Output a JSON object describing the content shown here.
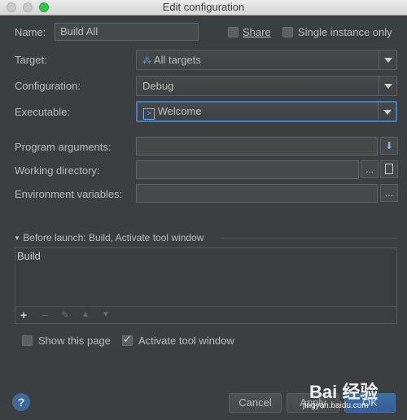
{
  "window": {
    "title": "Edit configuration"
  },
  "name": {
    "label": "Name:",
    "value": "Build All"
  },
  "share": {
    "label": "Share",
    "checked": false
  },
  "single_instance": {
    "label": "Single instance only",
    "checked": false
  },
  "target": {
    "label": "Target:",
    "value": "All targets",
    "icon": "targets-icon"
  },
  "configuration": {
    "label": "Configuration:",
    "value": "Debug"
  },
  "executable": {
    "label": "Executable:",
    "value": "Welcome",
    "icon": "terminal-icon"
  },
  "program_arguments": {
    "label": "Program arguments:",
    "value": ""
  },
  "working_directory": {
    "label": "Working directory:",
    "value": "",
    "browse": "..."
  },
  "environment_variables": {
    "label": "Environment variables:",
    "value": "",
    "browse": "..."
  },
  "before_launch": {
    "header": "Before launch: Build, Activate tool window",
    "items": [
      "Build"
    ],
    "toolbar": [
      "+",
      "−",
      "✎",
      "▲",
      "▼"
    ]
  },
  "show_this_page": {
    "label": "Show this page",
    "checked": false
  },
  "activate_tool_window": {
    "label": "Activate tool window",
    "checked": true
  },
  "footer": {
    "help": "?",
    "cancel": "Cancel",
    "apply": "Apply",
    "ok": "OK"
  },
  "watermark": {
    "line1": "Bai 经验",
    "line2": "jingyan.baidu.com"
  },
  "colors": {
    "background": "#3c3f41",
    "focus": "#3d7fc5",
    "primary": "#3b6fa9"
  }
}
